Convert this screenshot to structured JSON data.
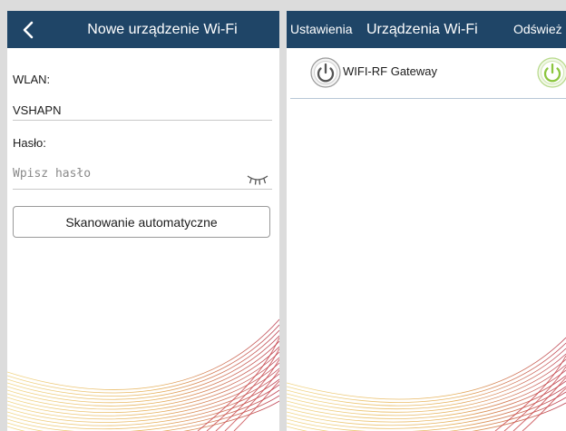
{
  "left_screen": {
    "header": {
      "back_icon": "chevron-left-icon",
      "title": "Nowe urządzenie Wi-Fi"
    },
    "wlan_label": "WLAN:",
    "wlan_value": "VSHAPN",
    "password_label": "Hasło:",
    "password_placeholder": "Wpisz hasło",
    "password_toggle_icon": "eye-closed-icon",
    "scan_button": "Skanowanie automatyczne"
  },
  "right_screen": {
    "header": {
      "left": "Ustawienia",
      "title": "Urządzenia Wi-Fi",
      "right": "Odśwież"
    },
    "devices": [
      {
        "name": "WIFI-RF Gateway",
        "icon": "power-icon",
        "status_icon": "power-icon",
        "status_color": "#8cc63f"
      }
    ]
  },
  "colors": {
    "header_bg": "#1f4567",
    "header_text": "#ffffff",
    "accent_green": "#8cc63f",
    "swirl_gold": "#e0b64a",
    "swirl_red": "#c43a40"
  }
}
